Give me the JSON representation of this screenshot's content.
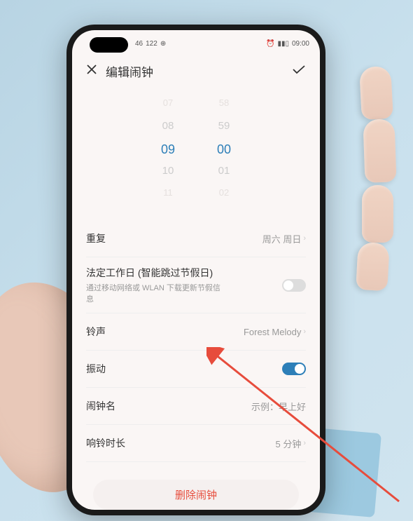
{
  "statusBar": {
    "signal": "46",
    "network": "122",
    "icons": "⊕",
    "alarm": "⏰",
    "battery": "▮▮▯",
    "time": "09:00"
  },
  "header": {
    "title": "编辑闹钟"
  },
  "timePicker": {
    "hours": [
      "07",
      "08",
      "09",
      "10",
      "11"
    ],
    "minutes": [
      "58",
      "59",
      "00",
      "01",
      "02"
    ]
  },
  "settings": {
    "repeat": {
      "label": "重复",
      "value": "周六 周日"
    },
    "workday": {
      "label": "法定工作日 (智能跳过节假日)",
      "sublabel": "通过移动网络或 WLAN 下载更新节假信息"
    },
    "ringtone": {
      "label": "铃声",
      "value": "Forest Melody"
    },
    "vibrate": {
      "label": "振动"
    },
    "alarmName": {
      "label": "闹钟名",
      "value": "示例：早上好"
    },
    "duration": {
      "label": "响铃时长",
      "value": "5 分钟"
    }
  },
  "deleteButton": {
    "label": "删除闹钟"
  }
}
